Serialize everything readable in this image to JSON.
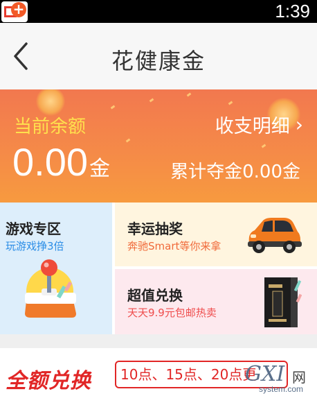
{
  "status_bar": {
    "time": "1:39",
    "app_icon": "app-plus-icon"
  },
  "header": {
    "title": "花健康金",
    "back_icon": "back-arrow-icon"
  },
  "balance": {
    "label": "当前余额",
    "value": "0.00",
    "unit": "金",
    "detail_link": "收支明细",
    "detail_chevron": "›",
    "total_won": "累计夺金0.00金"
  },
  "grid": {
    "games": {
      "title": "游戏专区",
      "subtitle": "玩游戏挣3倍",
      "icon": "joystick-icon"
    },
    "lottery": {
      "title": "幸运抽奖",
      "subtitle": "奔驰Smart等你来拿",
      "icon": "car-icon"
    },
    "exchange": {
      "title": "超值兑换",
      "subtitle": "天天9.9元包邮热卖",
      "icon": "product-box-icon"
    }
  },
  "bottom": {
    "title": "全额兑换",
    "tag": "10点、15点、20点更"
  },
  "watermark": {
    "main": "GXI",
    "cn": "网",
    "sub": "system.com"
  },
  "colors": {
    "banner_start": "#f2784f",
    "banner_end": "#f79a3f",
    "balance_label": "#ffe04d",
    "accent_red": "#e12626",
    "games_bg": "#ddeefb",
    "lottery_bg": "#fff5df",
    "exchange_bg": "#fde9ee"
  }
}
